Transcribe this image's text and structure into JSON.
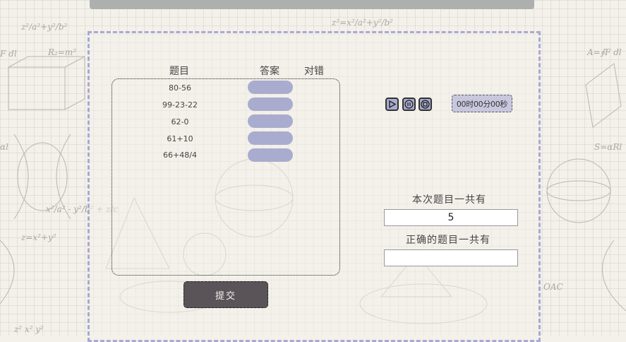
{
  "table": {
    "col_question": "题目",
    "col_answer": "答案",
    "col_correct": "对错",
    "questions": [
      "80-56",
      "99-23-22",
      "62-0",
      "61+10",
      "66+48/4"
    ]
  },
  "controls": {
    "play_icon": "play-icon",
    "pause_icon": "pause-icon",
    "stop_icon": "stop-icon",
    "timer": "00时00分00秒"
  },
  "summary": {
    "total_label": "本次题目一共有",
    "total_value": "5",
    "correct_label": "正确的题目一共有",
    "correct_value": ""
  },
  "submit_label": "提交",
  "colors": {
    "accent": "#a9acce",
    "panel_border": "#a9a9d3",
    "button": "#5a5458",
    "background": "#f3f1ea"
  }
}
